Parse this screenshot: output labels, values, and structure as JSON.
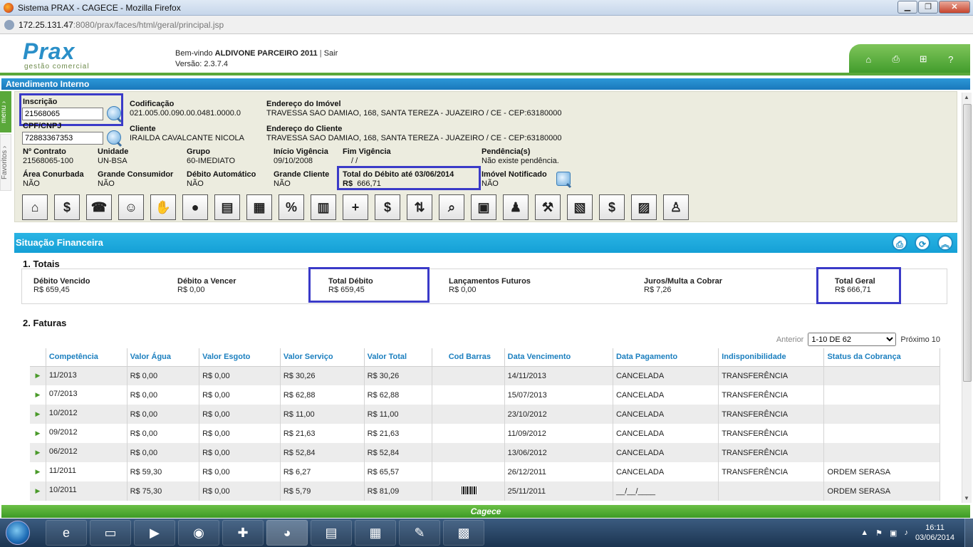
{
  "window": {
    "title": "Sistema PRAX - CAGECE - Mozilla Firefox",
    "minimize": "▁",
    "maximize": "❐",
    "close": "✕"
  },
  "browser": {
    "url_host": "172.25.131.47",
    "url_rest": ":8080/prax/faces/html/geral/principal.jsp"
  },
  "header": {
    "logo_name": "Prax",
    "logo_subtitle": "gestão comercial",
    "welcome_prefix": "Bem-vindo",
    "user": "ALDIVONE PARCEIRO 2011",
    "sep": "|",
    "logout": "Sair",
    "version_label": "Versão:",
    "version": "2.3.7.4",
    "toolbar_icons": [
      "home-icon",
      "print-icon",
      "sitemap-icon",
      "help-icon"
    ],
    "help_label": "?"
  },
  "atendimento": {
    "title": "Atendimento Interno"
  },
  "side_tabs": {
    "menu": "menu",
    "favoritos": "Favoritos"
  },
  "client": {
    "inscricao_label": "Inscrição",
    "inscricao_value": "21568065",
    "cpf_label": "CPF/CNPJ",
    "cpf_value": "72883367353",
    "codificacao_label": "Codificação",
    "codificacao_value": "021.005.00.090.00.0481.0000.0",
    "end_imovel_label": "Endereço do Imóvel",
    "end_imovel_value": "TRAVESSA SAO DAMIAO, 168, SANTA TEREZA - JUAZEIRO / CE - CEP:63180000",
    "cliente_label": "Cliente",
    "cliente_value": "IRAILDA CAVALCANTE NICOLA",
    "end_cliente_label": "Endereço do Cliente",
    "end_cliente_value": "TRAVESSA SAO DAMIAO, 168, SANTA TEREZA - JUAZEIRO / CE - CEP:63180000",
    "contrato_label": "Nº Contrato",
    "contrato_value": "21568065-100",
    "unidade_label": "Unidade",
    "unidade_value": "UN-BSA",
    "grupo_label": "Grupo",
    "grupo_value": "60-IMEDIATO",
    "inicio_label": "Início Vigência",
    "inicio_value": "09/10/2008",
    "fim_label": "Fim Vigência",
    "fim_value": "/   /",
    "pendencia_label": "Pendência(s)",
    "pendencia_value": "Não existe pendência.",
    "area_label": "Área Conurbada",
    "area_value": "NÃO",
    "grande_cons_label": "Grande Consumidor",
    "grande_cons_value": "NÃO",
    "debito_auto_label": "Débito Automático",
    "debito_auto_value": "NÃO",
    "grande_cli_label": "Grande Cliente",
    "grande_cli_value": "NÃO",
    "total_debito_label": "Total do Débito até 03/06/2014",
    "total_debito_currency": "R$",
    "total_debito_value": "666,71",
    "notificado_label": "Imóvel Notificado",
    "notificado_value": "NÃO"
  },
  "tool_icons": [
    {
      "name": "house-icon",
      "glyph": "⌂"
    },
    {
      "name": "dollar-icon",
      "glyph": "$"
    },
    {
      "name": "phone-icon",
      "glyph": "☎"
    },
    {
      "name": "smiley-headset-icon",
      "glyph": "☺"
    },
    {
      "name": "handshake-icon",
      "glyph": "✋"
    },
    {
      "name": "coins-icon",
      "glyph": "●"
    },
    {
      "name": "money-stack-icon",
      "glyph": "▤"
    },
    {
      "name": "cash-register-icon",
      "glyph": "▦"
    },
    {
      "name": "percent-icon",
      "glyph": "%"
    },
    {
      "name": "document-icon",
      "glyph": "▥"
    },
    {
      "name": "coins-add-icon",
      "glyph": "+"
    },
    {
      "name": "money-bag-icon",
      "glyph": "$"
    },
    {
      "name": "transfer-arrows-icon",
      "glyph": "⇅"
    },
    {
      "name": "search-document-icon",
      "glyph": "⌕"
    },
    {
      "name": "bank-icon",
      "glyph": "▣"
    },
    {
      "name": "users-icon",
      "glyph": "♟"
    },
    {
      "name": "gavel-icon",
      "glyph": "⚒"
    },
    {
      "name": "calculator-money-icon",
      "glyph": "▧"
    },
    {
      "name": "dollar-sign-blue-icon",
      "glyph": "$"
    },
    {
      "name": "chart-money-icon",
      "glyph": "▨"
    },
    {
      "name": "person-money-icon",
      "glyph": "♙"
    }
  ],
  "financeira": {
    "title": "Situação Financeira",
    "actions": [
      {
        "name": "print-icon",
        "glyph": "⎙"
      },
      {
        "name": "refresh-icon",
        "glyph": "⟳"
      },
      {
        "name": "collapse-icon",
        "glyph": "︽"
      }
    ],
    "totais_title": "1. Totais",
    "totais": {
      "vencido_label": "Débito Vencido",
      "vencido_value": "R$ 659,45",
      "a_vencer_label": "Débito a Vencer",
      "a_vencer_value": "R$ 0,00",
      "total_label": "Total Débito",
      "total_value": "R$ 659,45",
      "futuros_label": "Lançamentos Futuros",
      "futuros_value": "R$ 0,00",
      "juros_label": "Juros/Multa a Cobrar",
      "juros_value": "R$ 7,26",
      "geral_label": "Total Geral",
      "geral_value": "R$ 666,71"
    },
    "faturas_title": "2. Faturas",
    "pager": {
      "prev": "Anterior",
      "selected": "1-10 DE 62",
      "next": "Próximo 10"
    },
    "columns": [
      "Competência",
      "Valor Água",
      "Valor Esgoto",
      "Valor Serviço",
      "Valor Total",
      "Cod Barras",
      "Data Vencimento",
      "Data Pagamento",
      "Indisponibilidade",
      "Status da Cobrança"
    ],
    "rows": [
      {
        "comp": "11/2013",
        "agua": "R$ 0,00",
        "esgoto": "R$ 0,00",
        "servico": "R$ 30,26",
        "total": "R$ 30,26",
        "venc": "14/11/2013",
        "pag": "CANCELADA",
        "indisp": "TRANSFERÊNCIA",
        "status": ""
      },
      {
        "comp": "07/2013",
        "agua": "R$ 0,00",
        "esgoto": "R$ 0,00",
        "servico": "R$ 62,88",
        "total": "R$ 62,88",
        "venc": "15/07/2013",
        "pag": "CANCELADA",
        "indisp": "TRANSFERÊNCIA",
        "status": ""
      },
      {
        "comp": "10/2012",
        "agua": "R$ 0,00",
        "esgoto": "R$ 0,00",
        "servico": "R$ 11,00",
        "total": "R$ 11,00",
        "venc": "23/10/2012",
        "pag": "CANCELADA",
        "indisp": "TRANSFERÊNCIA",
        "status": ""
      },
      {
        "comp": "09/2012",
        "agua": "R$ 0,00",
        "esgoto": "R$ 0,00",
        "servico": "R$ 21,63",
        "total": "R$ 21,63",
        "venc": "11/09/2012",
        "pag": "CANCELADA",
        "indisp": "TRANSFERÊNCIA",
        "status": ""
      },
      {
        "comp": "06/2012",
        "agua": "R$ 0,00",
        "esgoto": "R$ 0,00",
        "servico": "R$ 52,84",
        "total": "R$ 52,84",
        "venc": "13/06/2012",
        "pag": "CANCELADA",
        "indisp": "TRANSFERÊNCIA",
        "status": ""
      },
      {
        "comp": "11/2011",
        "agua": "R$ 59,30",
        "esgoto": "R$ 0,00",
        "servico": "R$ 6,27",
        "total": "R$ 65,57",
        "venc": "26/12/2011",
        "pag": "CANCELADA",
        "indisp": "TRANSFERÊNCIA",
        "status": "ORDEM SERASA"
      },
      {
        "comp": "10/2011",
        "agua": "R$ 75,30",
        "esgoto": "R$ 0,00",
        "servico": "R$ 5,79",
        "total": "R$ 81,09",
        "barcode": true,
        "venc": "25/11/2011",
        "pag": "__/__/____",
        "indisp": "",
        "status": "ORDEM SERASA"
      }
    ]
  },
  "footer": {
    "brand": "Cagece"
  },
  "taskbar": {
    "apps": [
      {
        "name": "ie-icon",
        "glyph": "e"
      },
      {
        "name": "explorer-icon",
        "glyph": "▭"
      },
      {
        "name": "media-player-icon",
        "glyph": "▶"
      },
      {
        "name": "chrome-icon",
        "glyph": "◉"
      },
      {
        "name": "app-red-icon",
        "glyph": "✚"
      },
      {
        "name": "firefox-icon",
        "glyph": "◕"
      },
      {
        "name": "documents-icon",
        "glyph": "▤"
      },
      {
        "name": "presentation-icon",
        "glyph": "▦"
      },
      {
        "name": "notepad-icon",
        "glyph": "✎"
      },
      {
        "name": "calculator-icon",
        "glyph": "▩"
      }
    ],
    "time": "16:11",
    "date": "03/06/2014"
  }
}
